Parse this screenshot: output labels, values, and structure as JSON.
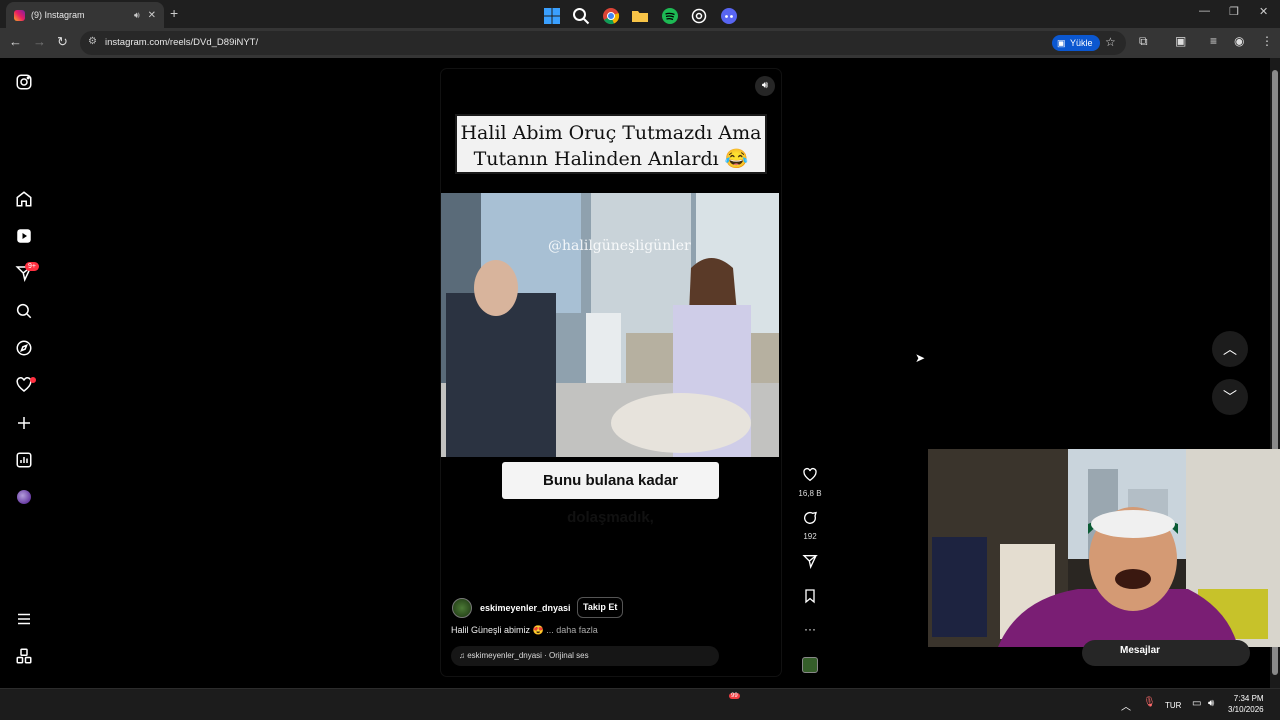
{
  "browser": {
    "tab_title": "(9) Instagram",
    "url": "instagram.com/reels/DVd_D89iNYT/",
    "upload_label": "Yükle"
  },
  "sidebar": {
    "notification_badge": "9+"
  },
  "reel": {
    "title_line1": "Halil Abim Oruç Tutmazdı Ama",
    "title_line2": "Tutanın Halinden Anlardı 😂",
    "watermark": "@halilgüneşligünler",
    "subtitle": "Bunu bulana kadar dolaşmadık,",
    "account": "eskimeyenler_dnyasi",
    "follow_label": "Takip Et",
    "caption": "Halil Güneşli abimiz 😍",
    "caption_more": "... daha fazla",
    "audio": "eskimeyenler_dnyasi · Orijinal ses"
  },
  "actions": {
    "likes": "16,8 B",
    "comments": "192"
  },
  "messages": {
    "label": "Mesajlar"
  },
  "taskbar": {
    "language": "TUR",
    "time": "7:34 PM",
    "date": "3/10/2026",
    "discord_badge": "99"
  },
  "colors": {
    "background": "#000000",
    "notification_red": "#ff3040",
    "upload_blue": "#0b57d0"
  }
}
